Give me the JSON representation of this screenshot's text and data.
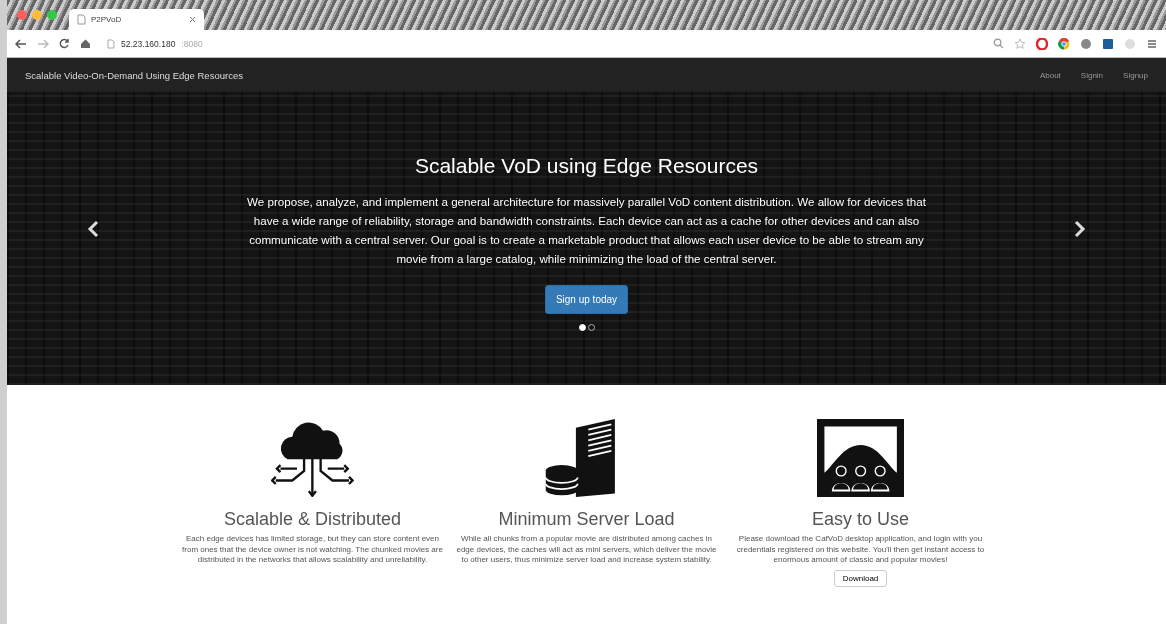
{
  "browser": {
    "tab_title": "P2PVoD",
    "url_host": "52.23.160.180",
    "url_port": ":8080"
  },
  "navbar": {
    "brand": "Scalable Video-On-Demand Using Edge Resources",
    "links": [
      "About",
      "Signin",
      "Signup"
    ]
  },
  "carousel": {
    "title": "Scalable VoD using Edge Resources",
    "text": "We propose, analyze, and implement a general architecture for massively parallel VoD content distribution. We allow for devices that have a wide range of reliability, storage and bandwidth constraints. Each device can act as a cache for other devices and can also communicate with a central server. Our goal is to create a marketable product that allows each user device to be able to stream any movie from a large catalog, while minimizing the load of the central server.",
    "button": "Sign up today",
    "indicators": [
      {
        "selected": true
      },
      {
        "selected": false
      }
    ]
  },
  "features": [
    {
      "title": "Scalable & Distributed",
      "text": "Each edge devices has limited storage, but they can store content even from ones that the device owner is not watching. The chunked movies are distributed in the networks that allows scalability and unreliability."
    },
    {
      "title": "Minimum Server Load",
      "text": "While all chunks from a popular movie are distributed among caches in edge devices, the caches will act as mini servers, which deliver the movie to other users, thus minimize server load and increase system stability."
    },
    {
      "title": "Easy to Use",
      "text": "Please download the CafVoD desktop application, and login with you credentials registered on this website. You'll then get instant access to enormous amount of classic and popular movies!",
      "button": "Download"
    }
  ]
}
